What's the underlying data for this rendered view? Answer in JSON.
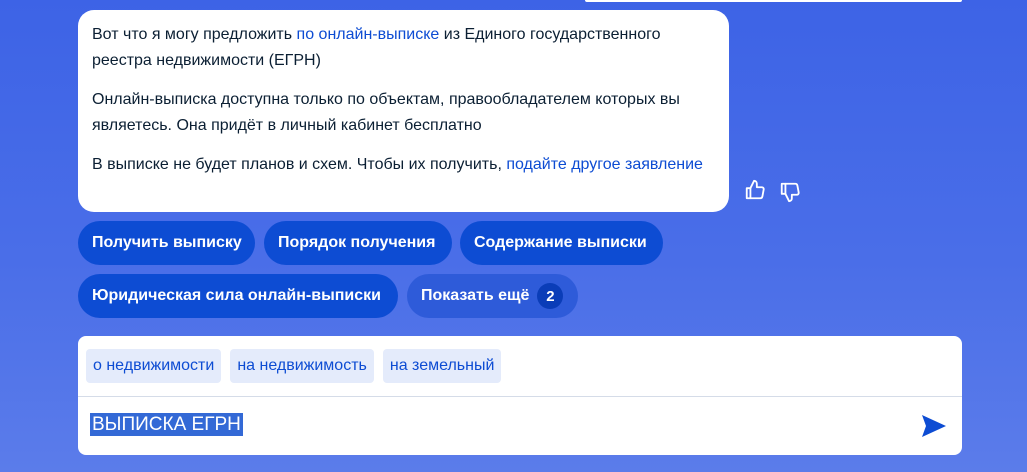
{
  "message": {
    "p1_a": "Вот что я могу предложить ",
    "p1_link": "по онлайн-выписке",
    "p1_b": " из Единого государственного реестра недвижимости (ЕГРН)",
    "p2": "Онлайн-выписка доступна только по объектам, правообладателем которых вы являетесь. Она придёт в личный кабинет бесплатно",
    "p3_a": "В выписке не будет планов и схем. Чтобы их получить, ",
    "p3_link": "подайте другое заявление"
  },
  "feedback": {
    "like_icon": "thumbs-up-icon",
    "dislike_icon": "thumbs-down-icon"
  },
  "quick_replies": [
    {
      "label": "Получить выписку"
    },
    {
      "label": "Порядок получения"
    },
    {
      "label": "Содержание выписки"
    },
    {
      "label": "Юридическая сила онлайн-выписки"
    },
    {
      "label": "Показать ещё",
      "count": "2"
    }
  ],
  "input": {
    "suggestions": [
      "о недвижимости",
      "на недвижимость",
      "на земельный"
    ],
    "value": "ВЫПИСКА ЕГРН",
    "send_icon": "send-arrow-icon"
  },
  "colors": {
    "background": "#3d63e6",
    "accent": "#0d4cd3",
    "chip_alt": "#2e5bd9",
    "suggestion_bg": "#e4ebfb"
  }
}
